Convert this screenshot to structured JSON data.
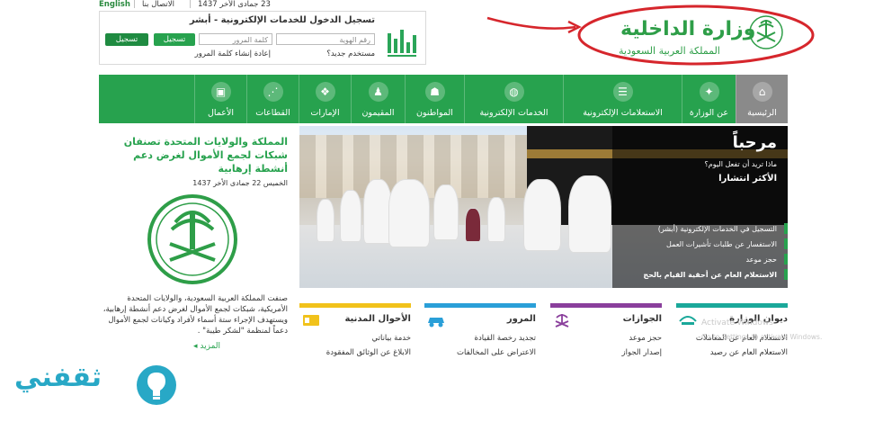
{
  "topbar": {
    "english": "English",
    "contact": "الاتصال بنا",
    "date": "23 جمادى الأخر 1437"
  },
  "login": {
    "title": "تسجيل الدخول للخدمات الإلكترونية - أبشر",
    "id_placeholder": "رقم الهوية",
    "password_placeholder": "كلمة المرور",
    "login_button": "تسجيل الدخول",
    "login_button_alt": "تسجيل الدخول",
    "new_user": "مستخدم جديد؟",
    "create_password": "إعادة إنشاء كلمة المرور"
  },
  "logo": {
    "title": "وزارة الداخلية",
    "subtitle": "المملكة العربية السعودية"
  },
  "nav": {
    "items": [
      {
        "label": "الرئيسية",
        "icon": "home-icon"
      },
      {
        "label": "عن الوزارة",
        "icon": "emblem-icon"
      },
      {
        "label": "الاستعلامات الإلكترونية",
        "icon": "inquiries-icon"
      },
      {
        "label": "الخدمات الإلكترونية",
        "icon": "globe-icon"
      },
      {
        "label": "المواطنون",
        "icon": "citizen-icon"
      },
      {
        "label": "المقيمون",
        "icon": "residents-icon"
      },
      {
        "label": "الإمارات",
        "icon": "map-icon"
      },
      {
        "label": "القطاعات",
        "icon": "network-icon"
      },
      {
        "label": "الأعمال",
        "icon": "briefcase-icon"
      }
    ]
  },
  "news": {
    "title": "المملكة والولايات المتحدة تصنفان شبكات لجمع الأموال لغرض دعم أنشطة إرهابية",
    "date": "الخميس 22 جمادى الأخر 1437",
    "body": "صنفت المملكة العربية السعودية، والولايات المتحدة الأمريكية، شبكات لجمع الأموال لغرض دعم أنشطة إرهابية، ويستهدف الإجراء ستة أسماء لأفراد وكيانات لجمع الأموال دعماً لمنظمة \"لشكر طيبة\" .",
    "more": "المزيد"
  },
  "hero": {
    "welcome": "مرحباً",
    "question": "ماذا تريد أن تفعل اليوم؟",
    "popular": "الأكثر انتشارا",
    "links": [
      "التسجيل في الخدمات الإلكترونية (أبشر)",
      "الاستفسار عن طلبات تأشيرات العمل",
      "حجز موعد",
      "الاستعلام العام عن أحقية القيام بالحج"
    ]
  },
  "cards": [
    {
      "title": "ديوان الوزارة",
      "l1": "الاستعلام العام عن المعاملات",
      "l2": "الاستعلام العام عن رصيد",
      "color": "#1aa89a",
      "icon": "ministry-icon"
    },
    {
      "title": "الجوازات",
      "l1": "حجز موعد",
      "l2": "إصدار الجواز",
      "color": "#8a3f9c",
      "icon": "passport-icon"
    },
    {
      "title": "المرور",
      "l1": "تجديد رخصة القيادة",
      "l2": "الاعتراض على المخالفات",
      "color": "#2a9fd8",
      "icon": "car-icon"
    },
    {
      "title": "الأحوال المدنية",
      "l1": "خدمة بياناتي",
      "l2": "الابلاغ عن الوثائق المفقودة",
      "color": "#f1c21b",
      "icon": "id-card-icon"
    }
  ],
  "overlay": {
    "activate": "Activate Windows",
    "activate_sub": "Go to Settings to activate Windows."
  },
  "watermark": {
    "text": "ثقفني"
  }
}
